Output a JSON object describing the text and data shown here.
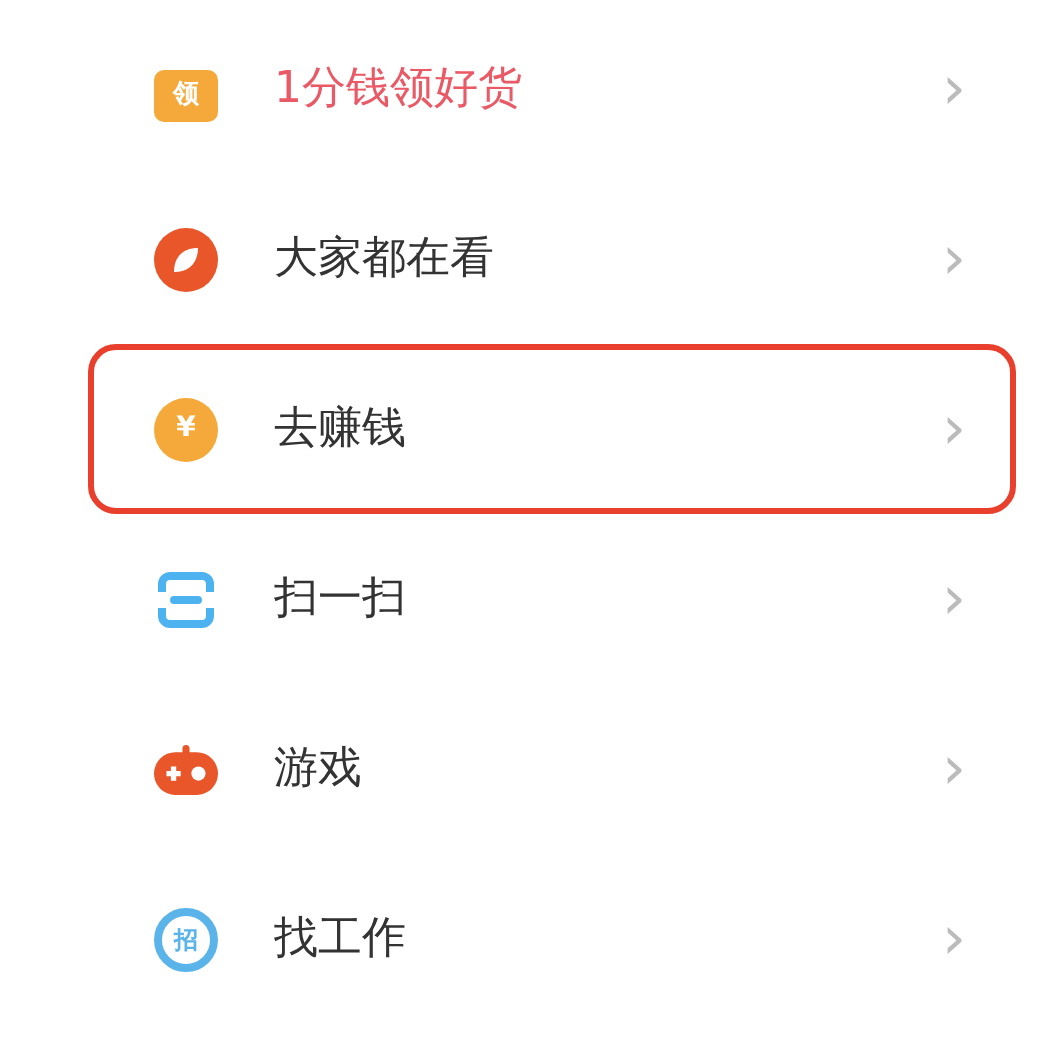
{
  "menu_items": [
    {
      "kind": "bag",
      "icon_text": "领",
      "label": "1分钱领好货",
      "emphasized": true,
      "highlighted": false,
      "chevron": "›"
    },
    {
      "kind": "compass",
      "label": "大家都在看",
      "emphasized": false,
      "highlighted": false,
      "chevron": "›"
    },
    {
      "kind": "coin",
      "icon_text": "¥",
      "label": "去赚钱",
      "emphasized": false,
      "highlighted": true,
      "chevron": "›"
    },
    {
      "kind": "scan",
      "label": "扫一扫",
      "emphasized": false,
      "highlighted": false,
      "chevron": "›"
    },
    {
      "kind": "gamepad",
      "label": "游戏",
      "emphasized": false,
      "highlighted": false,
      "chevron": "›"
    },
    {
      "kind": "job-search",
      "icon_text": "招",
      "label": "找工作",
      "emphasized": false,
      "highlighted": false,
      "chevron": "›"
    }
  ]
}
